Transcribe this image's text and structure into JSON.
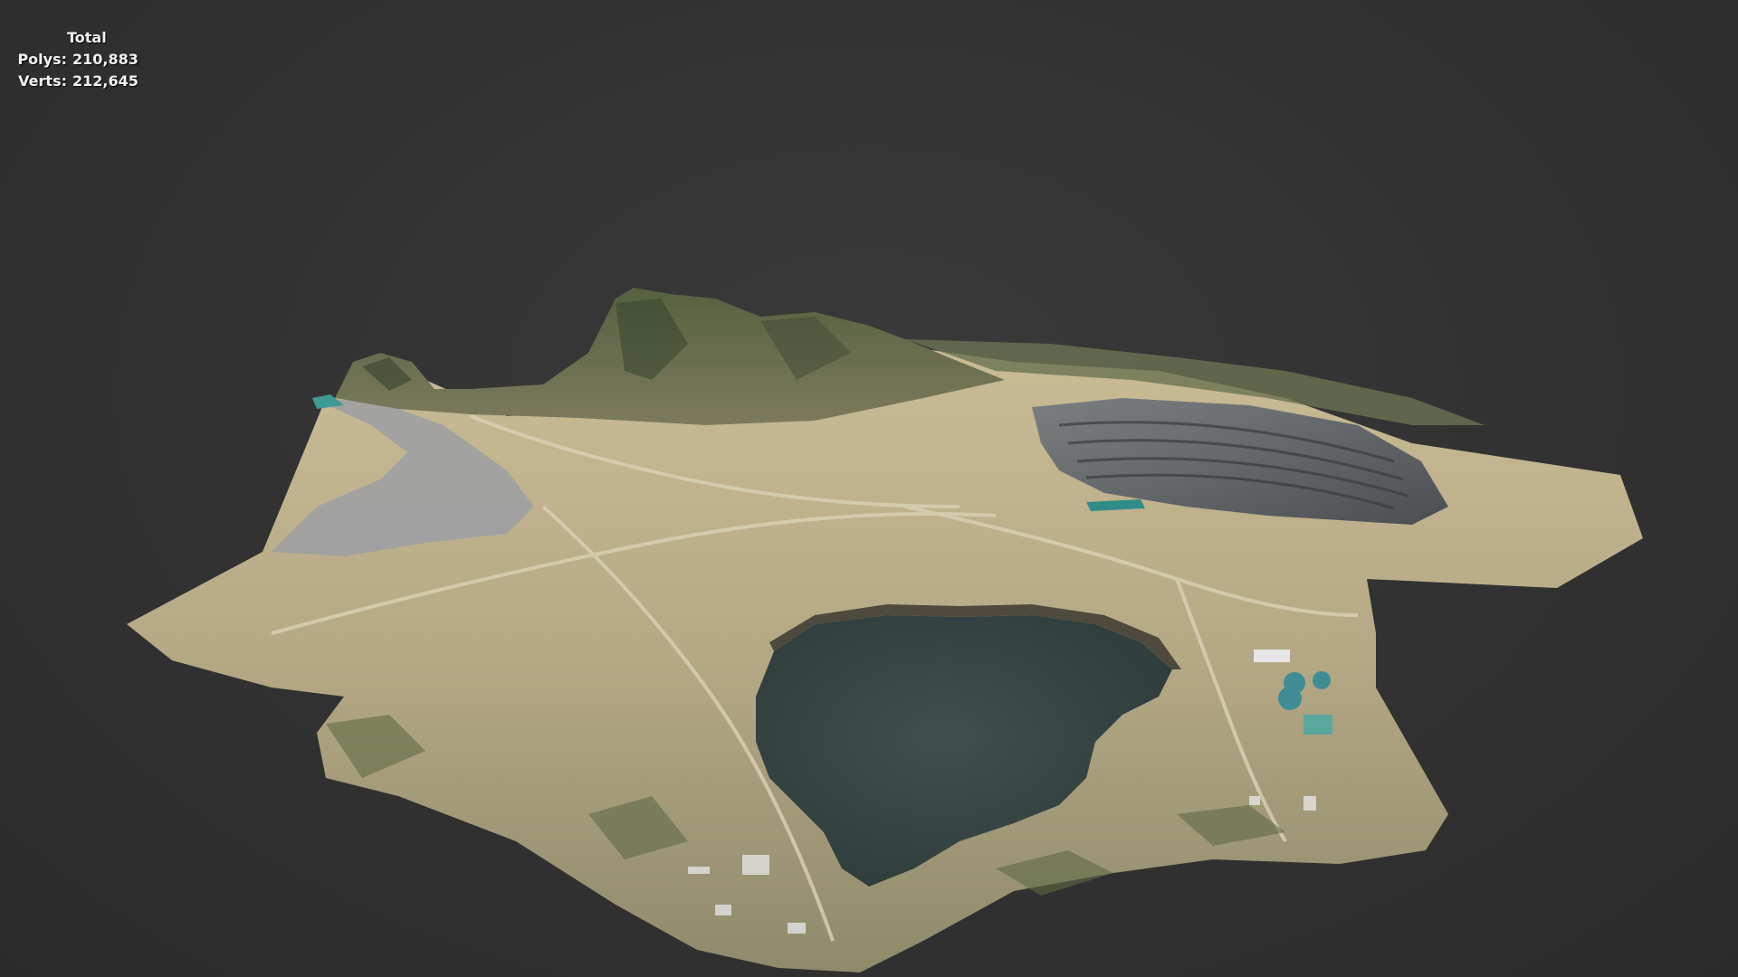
{
  "stats": {
    "header": "Total",
    "polys_label": "Polys:",
    "polys_value": "210,883",
    "verts_label": "Verts:",
    "verts_value": "212,645"
  },
  "scene": {
    "background_color": "#303030",
    "terrain_color": "#b8ab87",
    "water_color": "#3b4c4a",
    "vegetation_color": "#4b5a3c",
    "rock_color": "#6c6e72"
  }
}
